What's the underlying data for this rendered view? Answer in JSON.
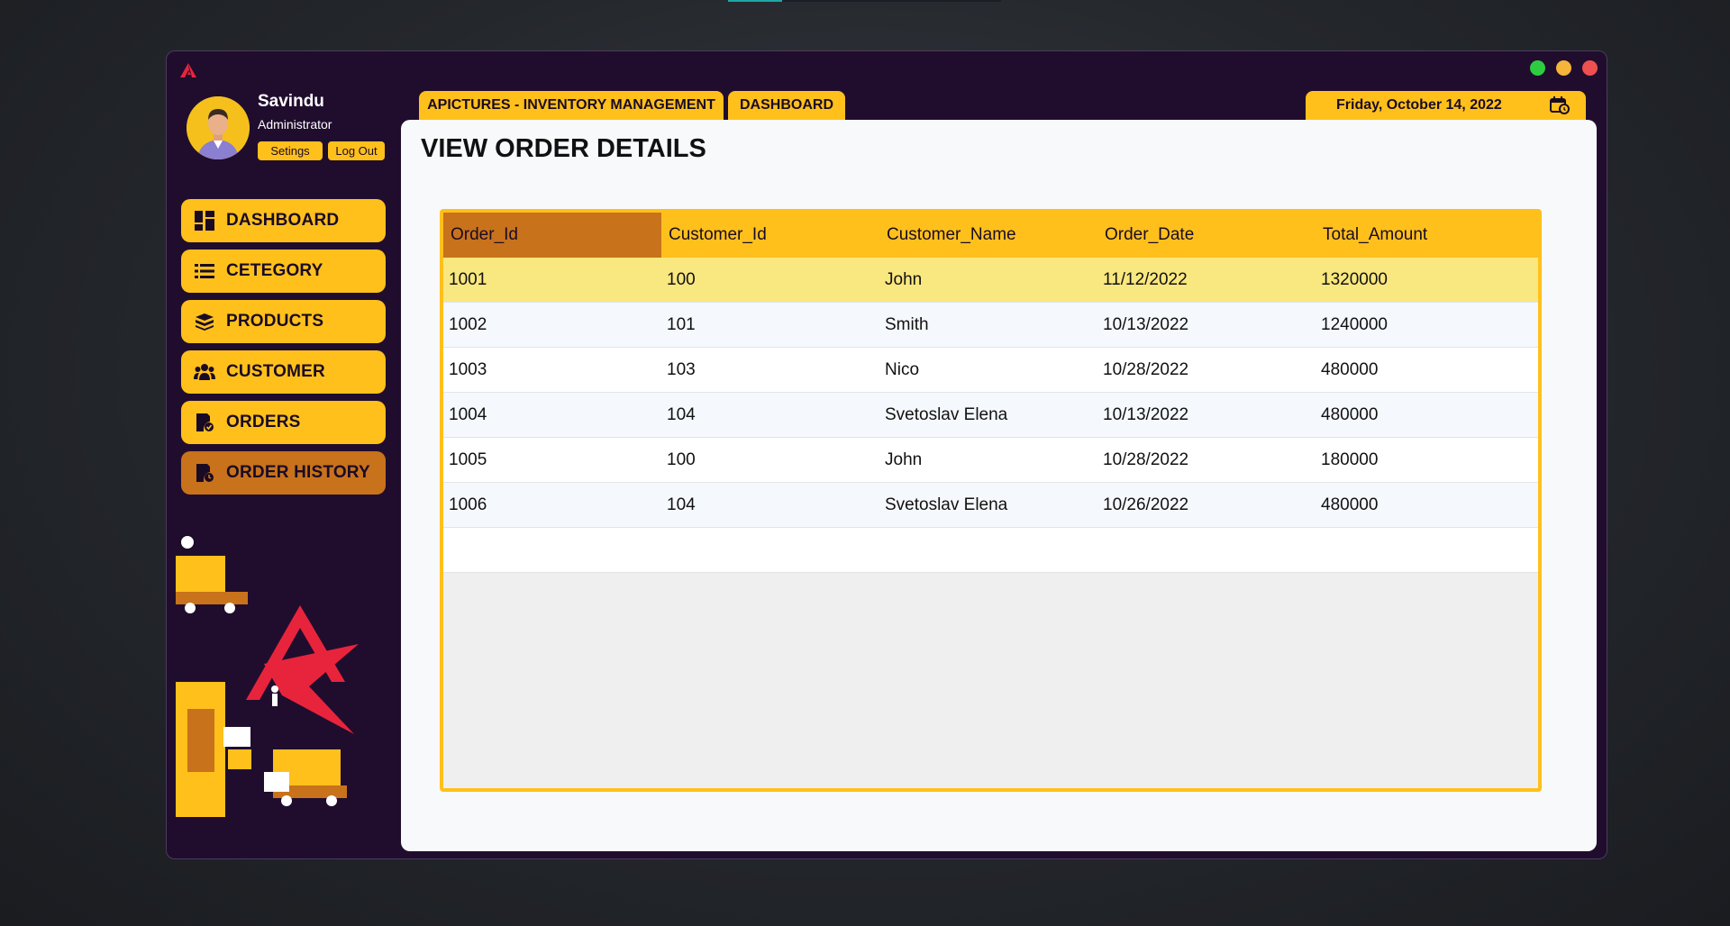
{
  "user": {
    "name": "Savindu",
    "role": "Administrator",
    "settings_label": "Setings",
    "logout_label": "Log Out"
  },
  "nav": {
    "items": [
      {
        "label": "DASHBOARD",
        "icon": "dashboard-icon"
      },
      {
        "label": "CETEGORY",
        "icon": "list-icon"
      },
      {
        "label": "PRODUCTS",
        "icon": "box-icon"
      },
      {
        "label": "CUSTOMER",
        "icon": "users-icon"
      },
      {
        "label": "ORDERS",
        "icon": "order-icon"
      },
      {
        "label": "ORDER HISTORY",
        "icon": "order-history-icon",
        "active": true
      }
    ]
  },
  "tabs": {
    "app_title": "APICTURES - INVENTORY MANAGEMENT",
    "current": "DASHBOARD"
  },
  "date": "Friday, October 14, 2022",
  "page_title": "VIEW ORDER DETAILS",
  "table": {
    "columns": [
      "Order_Id",
      "Customer_Id",
      "Customer_Name",
      "Order_Date",
      "Total_Amount"
    ],
    "rows": [
      [
        "1001",
        "100",
        "John",
        "11/12/2022",
        "1320000"
      ],
      [
        "1002",
        "101",
        "Smith",
        "10/13/2022",
        "1240000"
      ],
      [
        "1003",
        "103",
        "Nico",
        "10/28/2022",
        "480000"
      ],
      [
        "1004",
        "104",
        "Svetoslav Elena",
        "10/13/2022",
        "480000"
      ],
      [
        "1005",
        "100",
        "John",
        "10/28/2022",
        "180000"
      ],
      [
        "1006",
        "104",
        "Svetoslav Elena",
        "10/26/2022",
        "480000"
      ]
    ],
    "selected_row": 0
  },
  "colors": {
    "accent": "#ffc01c",
    "active": "#c8721c",
    "window_bg": "#200d2e",
    "selected_row": "#f9e77f"
  }
}
